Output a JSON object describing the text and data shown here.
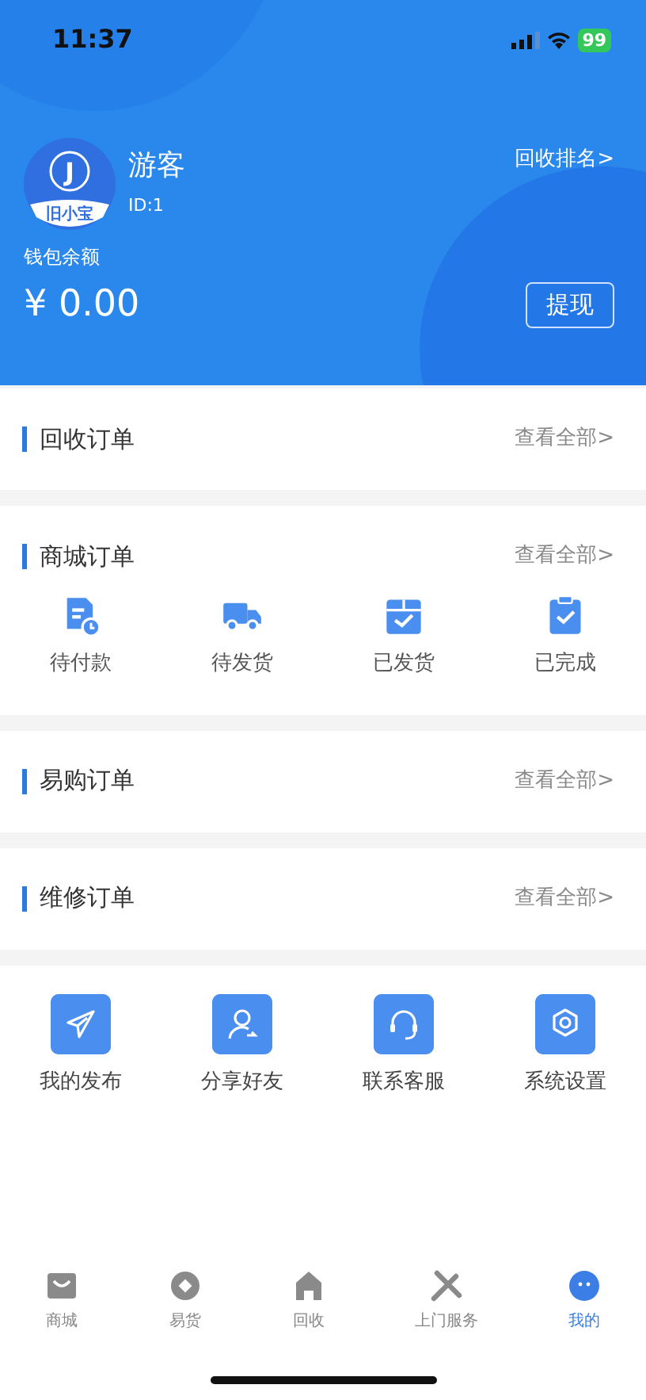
{
  "status_bar": {
    "time": "11:37",
    "battery": "99"
  },
  "profile": {
    "logo_letter": "J",
    "logo_caption": "旧小宝",
    "name": "游客",
    "id": "ID:1",
    "ranking_link": "回收排名>"
  },
  "wallet": {
    "label": "钱包余额",
    "amount": "¥ 0.00",
    "withdraw_button": "提现"
  },
  "sections": [
    {
      "title": "回收订单",
      "link": "查看全部>"
    },
    {
      "title": "商城订单",
      "link": "查看全部>",
      "items": [
        {
          "kind": "pay",
          "label": "待付款"
        },
        {
          "kind": "truck",
          "label": "待发货"
        },
        {
          "kind": "box",
          "label": "已发货"
        },
        {
          "kind": "done",
          "label": "已完成"
        }
      ]
    },
    {
      "title": "易购订单",
      "link": "查看全部>"
    },
    {
      "title": "维修订单",
      "link": "查看全部>"
    }
  ],
  "tools": [
    {
      "kind": "send",
      "label": "我的发布"
    },
    {
      "kind": "share",
      "label": "分享好友"
    },
    {
      "kind": "service",
      "label": "联系客服"
    },
    {
      "kind": "settings",
      "label": "系统设置"
    }
  ],
  "tab_bar": [
    {
      "kind": "shop",
      "label": "商城",
      "selected": false
    },
    {
      "kind": "coin",
      "label": "易货",
      "selected": false
    },
    {
      "kind": "home",
      "label": "回收",
      "selected": false
    },
    {
      "kind": "tools",
      "label": "上门服务",
      "selected": false
    },
    {
      "kind": "me",
      "label": "我的",
      "selected": true
    }
  ]
}
